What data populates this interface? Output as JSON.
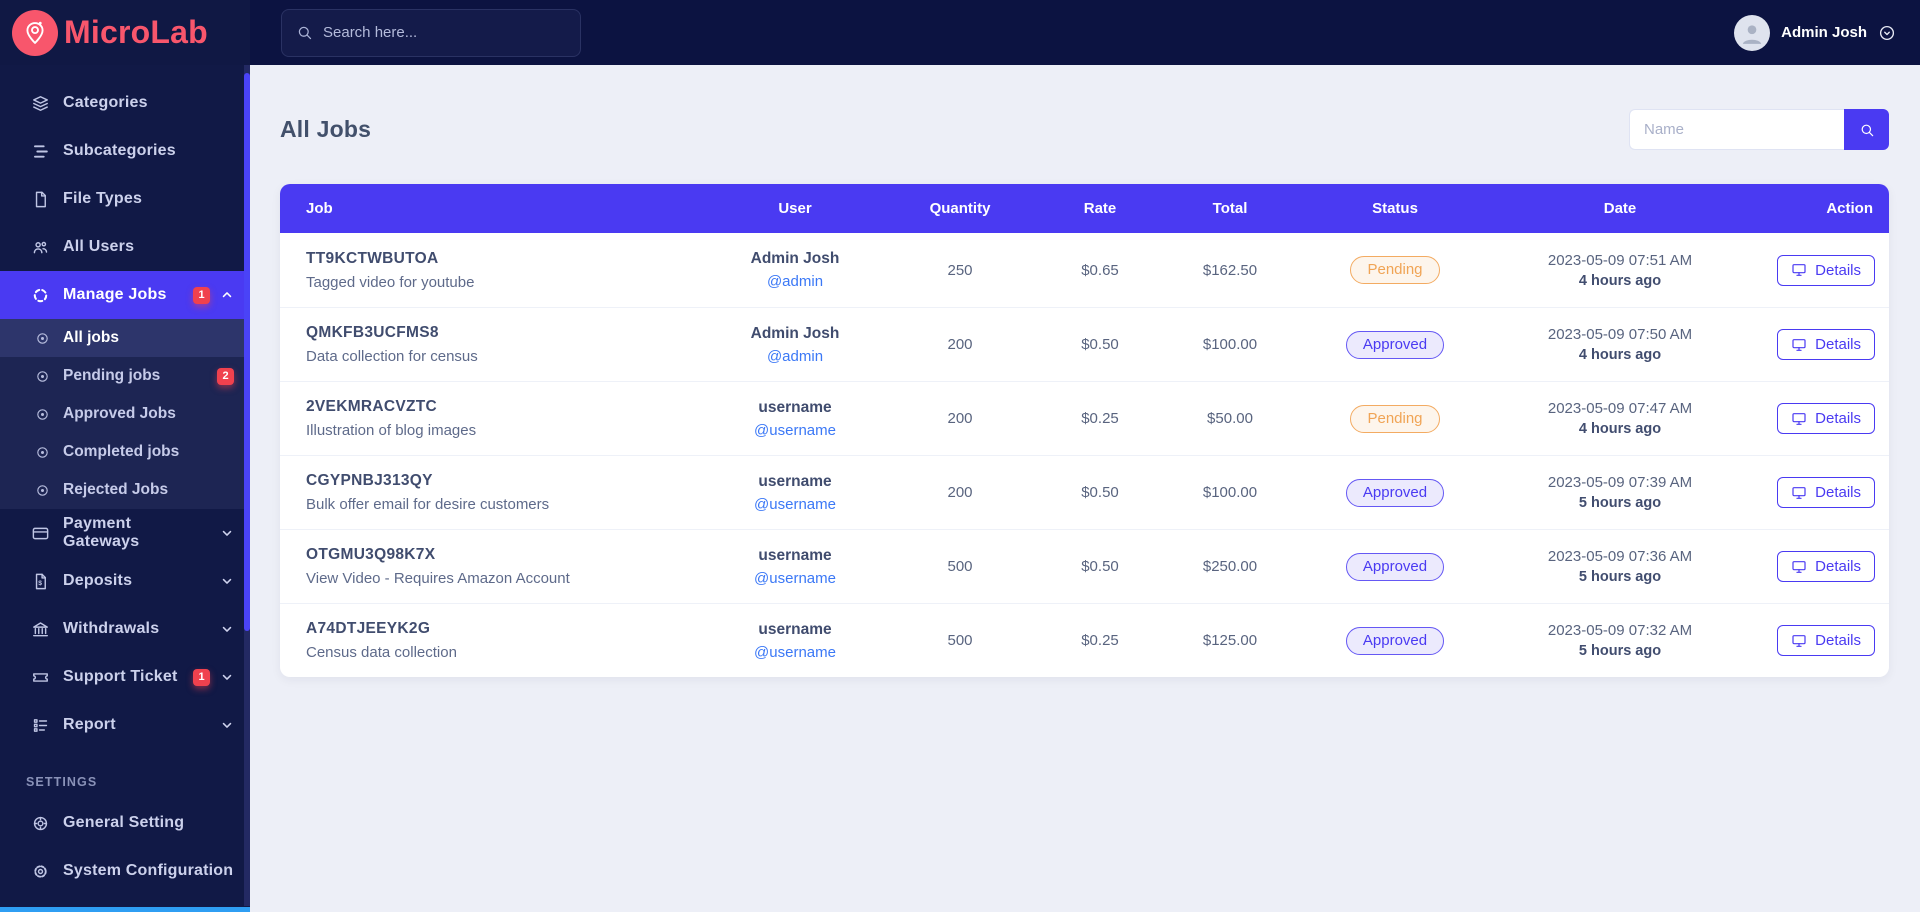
{
  "brand": {
    "name": "MicroLab"
  },
  "topbar": {
    "search_placeholder": "Search here...",
    "user_name": "Admin Josh"
  },
  "sidebar": {
    "items": [
      {
        "label": "Categories"
      },
      {
        "label": "Subcategories"
      },
      {
        "label": "File Types"
      },
      {
        "label": "All Users"
      },
      {
        "label": "Manage Jobs",
        "badge": "1"
      },
      {
        "label": "Payment Gateways"
      },
      {
        "label": "Deposits"
      },
      {
        "label": "Withdrawals"
      },
      {
        "label": "Support Ticket",
        "badge": "1"
      },
      {
        "label": "Report"
      }
    ],
    "manage_jobs_children": [
      {
        "label": "All jobs"
      },
      {
        "label": "Pending jobs",
        "badge": "2"
      },
      {
        "label": "Approved Jobs"
      },
      {
        "label": "Completed jobs"
      },
      {
        "label": "Rejected Jobs"
      }
    ],
    "settings_header": "SETTINGS",
    "settings_items": [
      {
        "label": "General Setting"
      },
      {
        "label": "System Configuration"
      }
    ]
  },
  "page": {
    "title": "All Jobs",
    "filter_placeholder": "Name"
  },
  "table": {
    "columns": [
      "Job",
      "User",
      "Quantity",
      "Rate",
      "Total",
      "Status",
      "Date",
      "Action"
    ],
    "details_label": "Details",
    "rows": [
      {
        "code": "TT9KCTWBUTOA",
        "title": "Tagged video for youtube",
        "user_name": "Admin Josh",
        "user_handle": "@admin",
        "quantity": "250",
        "rate": "$0.65",
        "total": "$162.50",
        "status": {
          "label": "Pending",
          "type": "pending"
        },
        "date": "2023-05-09 07:51 AM",
        "ago": "4 hours ago"
      },
      {
        "code": "QMKFB3UCFMS8",
        "title": "Data collection for census",
        "user_name": "Admin Josh",
        "user_handle": "@admin",
        "quantity": "200",
        "rate": "$0.50",
        "total": "$100.00",
        "status": {
          "label": "Approved",
          "type": "approved"
        },
        "date": "2023-05-09 07:50 AM",
        "ago": "4 hours ago"
      },
      {
        "code": "2VEKMRACVZTC",
        "title": "Illustration of blog images",
        "user_name": "username",
        "user_handle": "@username",
        "quantity": "200",
        "rate": "$0.25",
        "total": "$50.00",
        "status": {
          "label": "Pending",
          "type": "pending"
        },
        "date": "2023-05-09 07:47 AM",
        "ago": "4 hours ago"
      },
      {
        "code": "CGYPNBJ313QY",
        "title": "Bulk offer email for desire customers",
        "user_name": "username",
        "user_handle": "@username",
        "quantity": "200",
        "rate": "$0.50",
        "total": "$100.00",
        "status": {
          "label": "Approved",
          "type": "approved"
        },
        "date": "2023-05-09 07:39 AM",
        "ago": "5 hours ago"
      },
      {
        "code": "OTGMU3Q98K7X",
        "title": "View Video - Requires Amazon Account",
        "user_name": "username",
        "user_handle": "@username",
        "quantity": "500",
        "rate": "$0.50",
        "total": "$250.00",
        "status": {
          "label": "Approved",
          "type": "approved"
        },
        "date": "2023-05-09 07:36 AM",
        "ago": "5 hours ago"
      },
      {
        "code": "A74DTJEEYK2G",
        "title": "Census data collection",
        "user_name": "username",
        "user_handle": "@username",
        "quantity": "500",
        "rate": "$0.25",
        "total": "$125.00",
        "status": {
          "label": "Approved",
          "type": "approved"
        },
        "date": "2023-05-09 07:32 AM",
        "ago": "5 hours ago"
      }
    ]
  },
  "colors": {
    "accent": "#4a3af2",
    "brand": "#f8566c",
    "sidebar_bg": "#111946",
    "topbar_bg": "#0c1341",
    "content_bg": "#edeff7",
    "badge_red": "#f0414e",
    "pending": "#f0a455",
    "approved": "#4a3af2",
    "link_blue": "#3b78f6",
    "v_scrollbar": "#4a43f7",
    "h_scrollbar": "#2f9ef3"
  }
}
